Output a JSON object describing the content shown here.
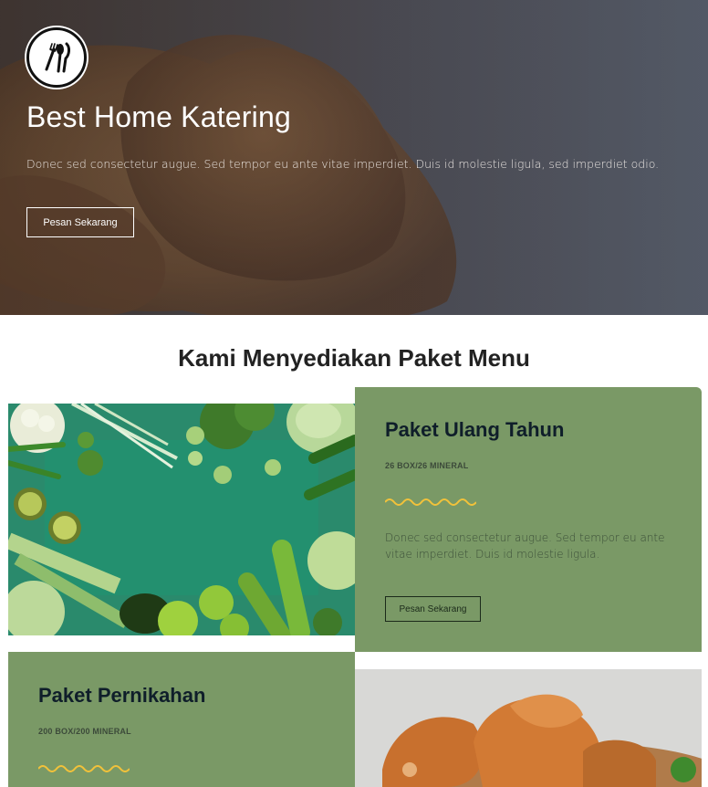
{
  "hero": {
    "title": "Best Home Katering",
    "subtitle": "Donec sed consectetur augue. Sed tempor eu ante vitae imperdiet. Duis id molestie ligula, sed imperdiet odio.",
    "button_label": "Pesan Sekarang",
    "logo_icon": "utensils-icon"
  },
  "section": {
    "title": "Kami Menyediakan Paket Menu"
  },
  "packages": [
    {
      "title": "Paket Ulang Tahun",
      "meta": "26 BOX/26 MINERAL",
      "description": "Donec sed consectetur augue. Sed tempor eu ante vitae imperdiet. Duis id molestie ligula.",
      "button_label": "Pesan Sekarang"
    },
    {
      "title": "Paket Pernikahan",
      "meta": "200 BOX/200 MINERAL"
    }
  ],
  "colors": {
    "card_green": "#7a9966",
    "wave_yellow": "#f2c23a",
    "heading_dark": "#0f1e2a"
  }
}
